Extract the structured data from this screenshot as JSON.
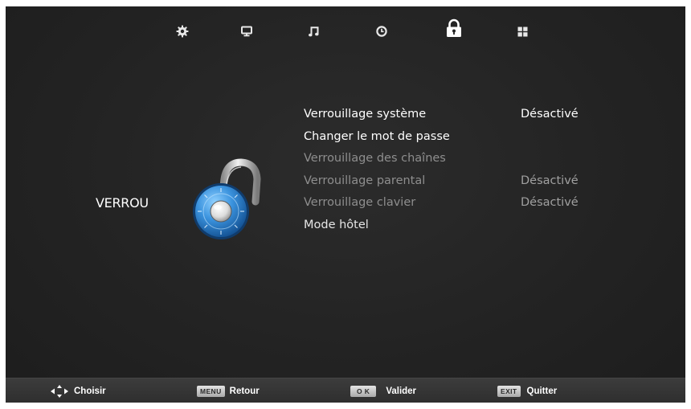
{
  "nav": {
    "items": [
      {
        "icon": "gear-icon",
        "selected": false
      },
      {
        "icon": "monitor-icon",
        "selected": false
      },
      {
        "icon": "music-note-icon",
        "selected": false
      },
      {
        "icon": "clock-icon",
        "selected": false
      },
      {
        "icon": "lock-icon",
        "selected": true
      },
      {
        "icon": "grid-icon",
        "selected": false
      }
    ]
  },
  "section": {
    "title": "VERROU",
    "icon": "combination-lock-icon"
  },
  "menu": {
    "items": [
      {
        "label": "Verrouillage système",
        "value": "Désactivé",
        "state": "active"
      },
      {
        "label": "Changer le mot de passe",
        "value": "",
        "state": "normal"
      },
      {
        "label": "Verrouillage des chaînes",
        "value": "",
        "state": "dim"
      },
      {
        "label": "Verrouillage parental",
        "value": "Désactivé",
        "state": "dim"
      },
      {
        "label": "Verrouillage clavier",
        "value": "Désactivé",
        "state": "dim"
      },
      {
        "label": "Mode hôtel",
        "value": "",
        "state": "normal"
      }
    ]
  },
  "footer": {
    "choose": {
      "icon": "dpad-arrows-icon",
      "label": "Choisir"
    },
    "back": {
      "key": "MENU",
      "label": "Retour"
    },
    "ok": {
      "key": "O K",
      "label": "Valider"
    },
    "exit": {
      "key": "EXIT",
      "label": "Quitter"
    }
  },
  "colors": {
    "background": "#232323",
    "text": "#ffffff",
    "dim_text": "#8e8e8e",
    "footer": "#333333",
    "lock_blue": "#2f86d4"
  }
}
